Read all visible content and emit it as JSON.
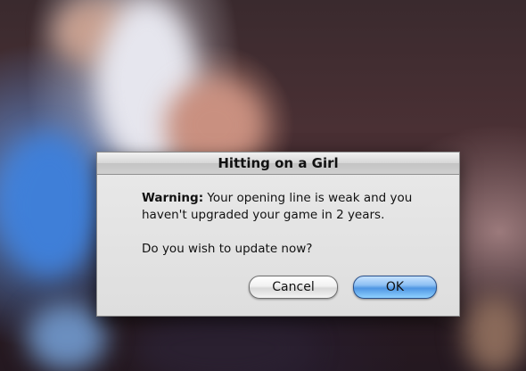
{
  "dialog": {
    "title": "Hitting on a Girl",
    "warning_label": "Warning:",
    "warning_text": " Your opening line is weak and you haven't upgraded your game in 2 years.",
    "question": "Do you wish to update now?",
    "cancel_label": "Cancel",
    "ok_label": "OK"
  },
  "colors": {
    "ok_button": "#5aa0e8",
    "dialog_bg": "#e4e4e4"
  }
}
